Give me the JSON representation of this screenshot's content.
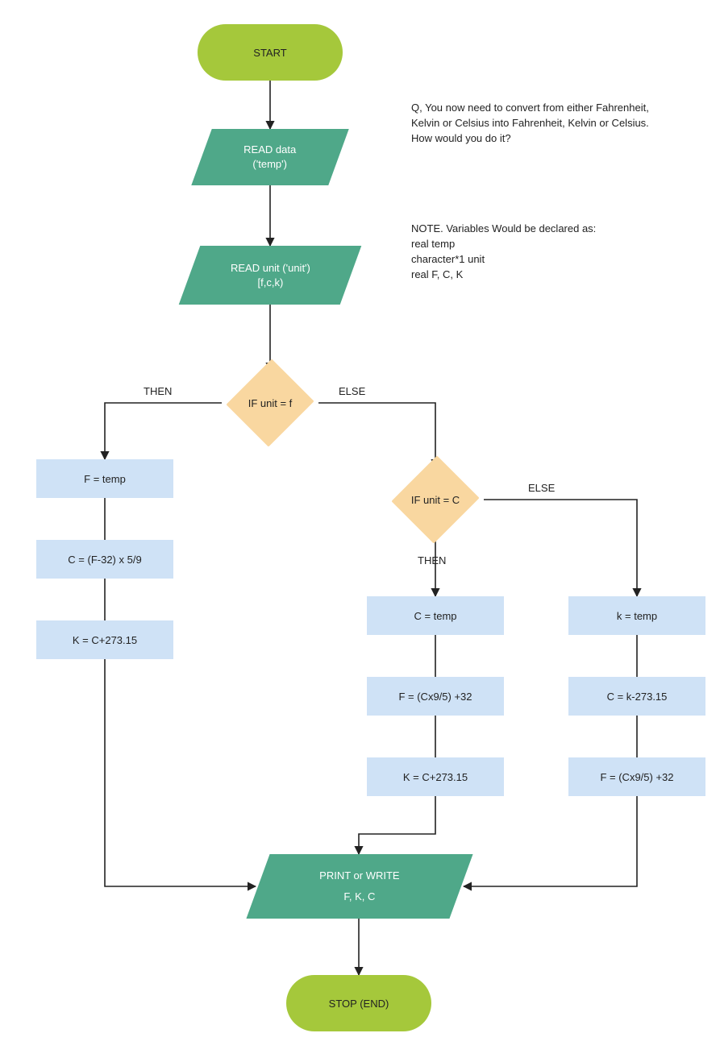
{
  "diagram": {
    "nodes": {
      "start": {
        "text": "START"
      },
      "read_data": {
        "line1": "READ data",
        "line2": "('temp')"
      },
      "read_unit": {
        "line1": "READ unit ('unit')",
        "line2": "[f,c,k)"
      },
      "dec_f": {
        "text": "IF unit = f"
      },
      "p_f1": {
        "text": "F = temp"
      },
      "p_f2": {
        "text": "C = (F-32) x 5/9"
      },
      "p_f3": {
        "text": "K = C+273.15"
      },
      "dec_c": {
        "text": "IF unit = C"
      },
      "p_c1": {
        "text": "C = temp"
      },
      "p_c2": {
        "text": "F = (Cx9/5) +32"
      },
      "p_c3": {
        "text": "K = C+273.15"
      },
      "p_k1": {
        "text": "k = temp"
      },
      "p_k2": {
        "text": "C = k-273.15"
      },
      "p_k3": {
        "text": "F = (Cx9/5) +32"
      },
      "print": {
        "line1": "PRINT or WRITE",
        "line2": "F, K, C"
      },
      "stop": {
        "text": "STOP (END)"
      }
    },
    "branch_labels": {
      "then1": "THEN",
      "else1": "ELSE",
      "then2": "THEN",
      "else2": "ELSE"
    },
    "notes": {
      "question": "Q, You now need to convert from either Fahrenheit,\nKelvin or Celsius into Fahrenheit, Kelvin or Celsius.\nHow would you do it?",
      "vars": "NOTE. Variables Would be declared as:\nreal temp\ncharacter*1 unit\nreal F, C, K"
    }
  },
  "chart_data": {
    "type": "flowchart",
    "nodes": [
      {
        "id": "start",
        "kind": "terminator",
        "label": "START"
      },
      {
        "id": "read_data",
        "kind": "io",
        "label": "READ data ('temp')"
      },
      {
        "id": "read_unit",
        "kind": "io",
        "label": "READ unit ('unit') [f,c,k)"
      },
      {
        "id": "dec_f",
        "kind": "decision",
        "label": "IF unit = f"
      },
      {
        "id": "p_f1",
        "kind": "process",
        "label": "F = temp"
      },
      {
        "id": "p_f2",
        "kind": "process",
        "label": "C = (F-32) x 5/9"
      },
      {
        "id": "p_f3",
        "kind": "process",
        "label": "K = C+273.15"
      },
      {
        "id": "dec_c",
        "kind": "decision",
        "label": "IF unit = C"
      },
      {
        "id": "p_c1",
        "kind": "process",
        "label": "C = temp"
      },
      {
        "id": "p_c2",
        "kind": "process",
        "label": "F = (Cx9/5) +32"
      },
      {
        "id": "p_c3",
        "kind": "process",
        "label": "K = C+273.15"
      },
      {
        "id": "p_k1",
        "kind": "process",
        "label": "k = temp"
      },
      {
        "id": "p_k2",
        "kind": "process",
        "label": "C = k-273.15"
      },
      {
        "id": "p_k3",
        "kind": "process",
        "label": "F = (Cx9/5) +32"
      },
      {
        "id": "print",
        "kind": "io",
        "label": "PRINT or WRITE F, K, C"
      },
      {
        "id": "stop",
        "kind": "terminator",
        "label": "STOP (END)"
      }
    ],
    "edges": [
      {
        "from": "start",
        "to": "read_data"
      },
      {
        "from": "read_data",
        "to": "read_unit"
      },
      {
        "from": "read_unit",
        "to": "dec_f"
      },
      {
        "from": "dec_f",
        "to": "p_f1",
        "label": "THEN"
      },
      {
        "from": "dec_f",
        "to": "dec_c",
        "label": "ELSE"
      },
      {
        "from": "p_f1",
        "to": "p_f2"
      },
      {
        "from": "p_f2",
        "to": "p_f3"
      },
      {
        "from": "p_f3",
        "to": "print"
      },
      {
        "from": "dec_c",
        "to": "p_c1",
        "label": "THEN"
      },
      {
        "from": "dec_c",
        "to": "p_k1",
        "label": "ELSE"
      },
      {
        "from": "p_c1",
        "to": "p_c2"
      },
      {
        "from": "p_c2",
        "to": "p_c3"
      },
      {
        "from": "p_c3",
        "to": "print"
      },
      {
        "from": "p_k1",
        "to": "p_k2"
      },
      {
        "from": "p_k2",
        "to": "p_k3"
      },
      {
        "from": "p_k3",
        "to": "print"
      },
      {
        "from": "print",
        "to": "stop"
      }
    ],
    "annotations": [
      "Q, You now need to convert from either Fahrenheit, Kelvin or Celsius into Fahrenheit, Kelvin or Celsius. How would you do it?",
      "NOTE. Variables Would be declared as: real temp; character*1 unit; real F, C, K"
    ]
  }
}
